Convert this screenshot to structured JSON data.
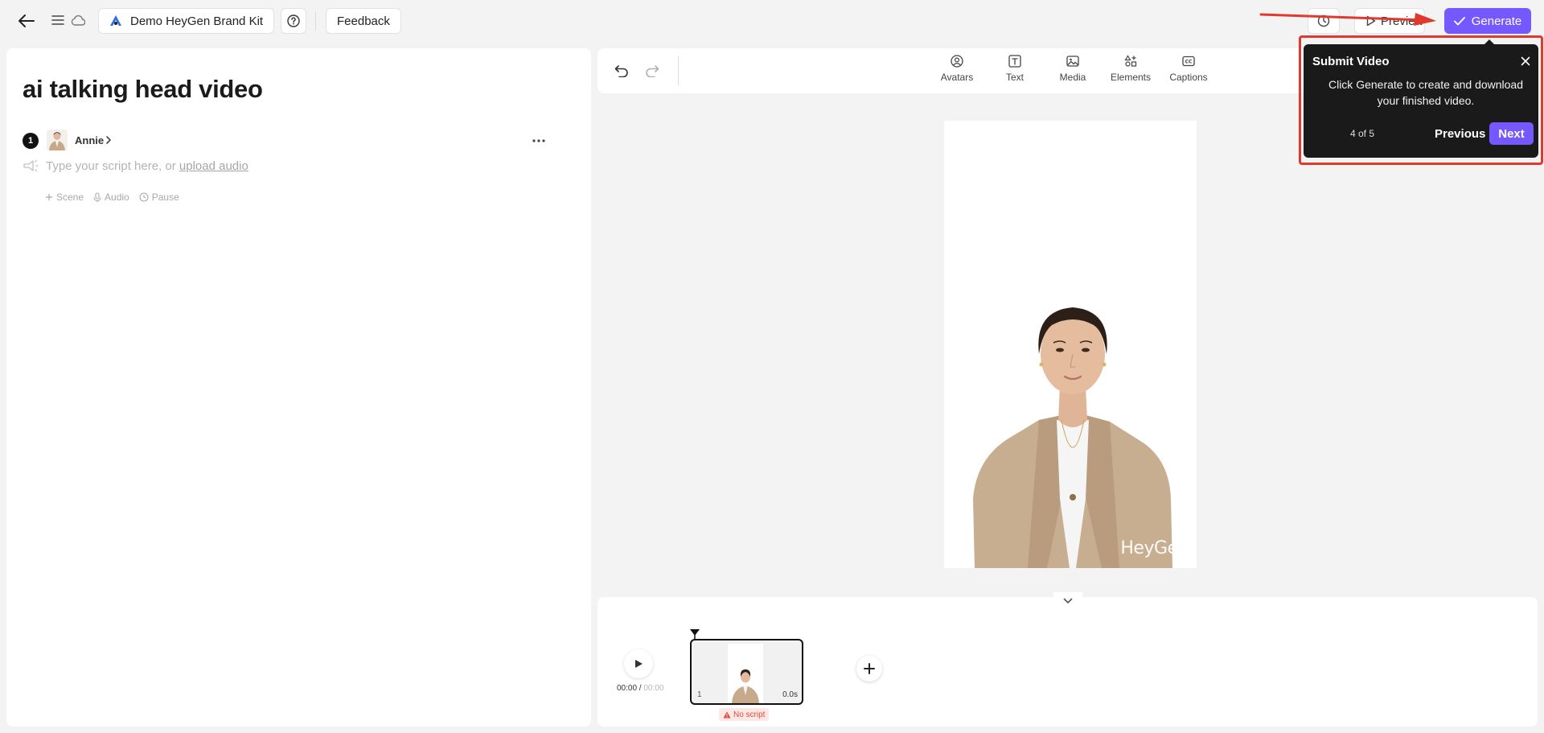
{
  "header": {
    "brand_kit_label": "Demo HeyGen Brand Kit",
    "feedback_label": "Feedback",
    "preview_label": "Preview",
    "generate_label": "Generate"
  },
  "script_panel": {
    "title": "ai talking head video",
    "scene_number": "1",
    "avatar_name": "Annie",
    "script_placeholder": "Type your script here, or",
    "upload_audio_link": "upload audio",
    "actions": [
      "Scene",
      "Audio",
      "Pause"
    ]
  },
  "toolbar": {
    "tools": [
      "Avatars",
      "Text",
      "Media",
      "Elements",
      "Captions"
    ]
  },
  "canvas": {
    "watermark": "HeyGen"
  },
  "timeline": {
    "current_time": "00:00",
    "separator": " / ",
    "total_time": "00:00",
    "clip_number": "1",
    "clip_duration": "0.0s",
    "warning": "No script"
  },
  "tour": {
    "title": "Submit Video",
    "body": "Click Generate to create and download your finished video.",
    "step": "4 of 5",
    "previous_label": "Previous",
    "next_label": "Next"
  },
  "colors": {
    "accent": "#7559ff",
    "highlight": "#e03a2f",
    "tooltip_bg": "#1a1a1a"
  },
  "icons": [
    "back-arrow-icon",
    "menu-icon",
    "cloud-icon",
    "brand-logo-icon",
    "help-icon",
    "history-icon",
    "play-outline-icon",
    "check-icon",
    "undo-icon",
    "redo-icon",
    "avatar-icon",
    "text-icon",
    "media-icon",
    "elements-icon",
    "captions-icon",
    "sparkle-icon",
    "plus-icon",
    "mic-icon",
    "pause-icon",
    "more-icon",
    "chevron-down-icon",
    "play-icon",
    "plus-icon",
    "warning-icon",
    "close-icon"
  ]
}
